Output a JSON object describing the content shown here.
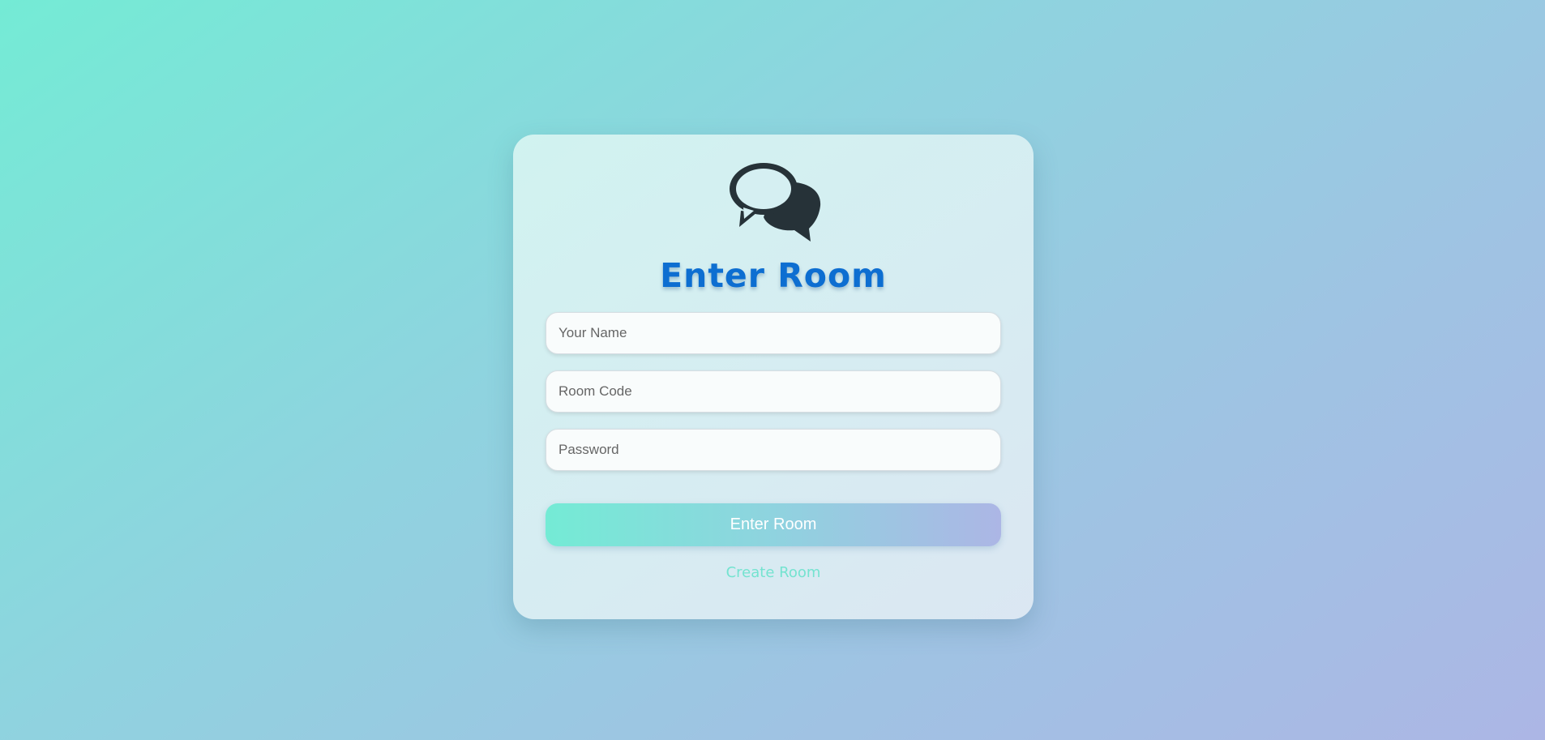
{
  "card": {
    "icon": "chat-bubbles-icon",
    "title": "Enter Room",
    "fields": {
      "name_placeholder": "Your Name",
      "room_code_placeholder": "Room Code",
      "password_placeholder": "Password"
    },
    "submit_label": "Enter Room",
    "create_link": "Create Room"
  },
  "colors": {
    "background_start": "#74ebd5",
    "background_end": "#acb6e5",
    "title": "#0d6ed1",
    "icon": "#263238",
    "link": "#74e3d0",
    "button_text": "#ffffff"
  }
}
